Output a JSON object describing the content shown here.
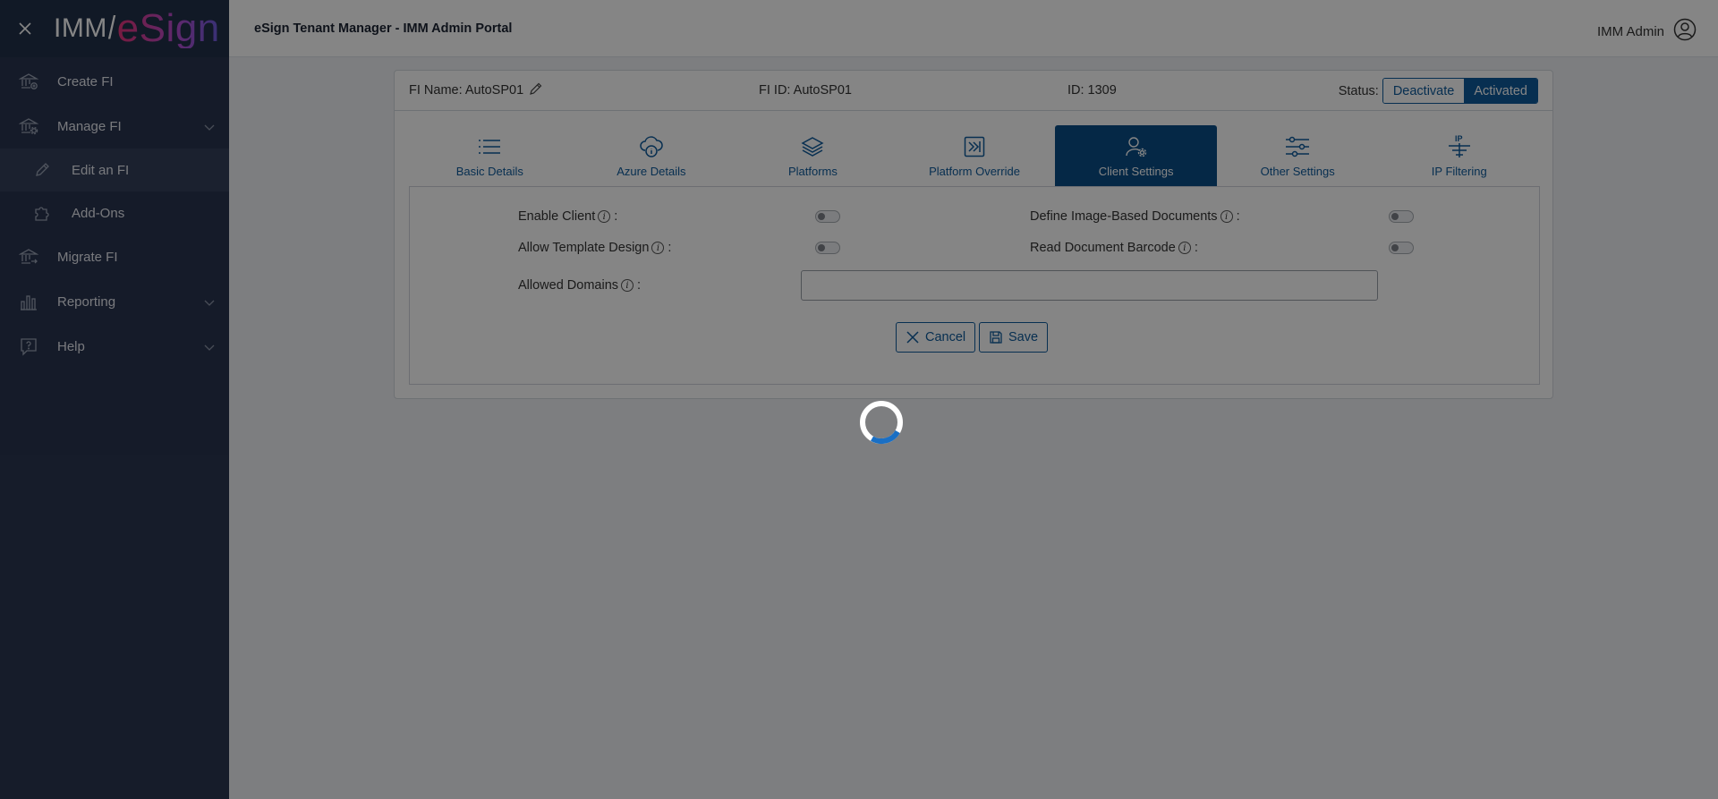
{
  "sidebar": {
    "logo_left": "IMM",
    "logo_right": "eSign",
    "items": [
      {
        "label": "Create FI"
      },
      {
        "label": "Manage FI"
      },
      {
        "label": "Edit an FI"
      },
      {
        "label": "Add-Ons"
      },
      {
        "label": "Migrate FI"
      },
      {
        "label": "Reporting"
      },
      {
        "label": "Help"
      }
    ]
  },
  "header": {
    "title": "eSign Tenant Manager - IMM Admin Portal",
    "user": "IMM Admin"
  },
  "fi": {
    "name": "FI Name: AutoSP01",
    "fi_id": "FI ID: AutoSP01",
    "id": "ID: 1309",
    "status_label": "Status:",
    "deactivate": "Deactivate",
    "activated": "Activated"
  },
  "tabs": [
    {
      "label": "Basic Details"
    },
    {
      "label": "Azure Details"
    },
    {
      "label": "Platforms"
    },
    {
      "label": "Platform Override"
    },
    {
      "label": "Client Settings"
    },
    {
      "label": "Other Settings"
    },
    {
      "label": "IP Filtering"
    }
  ],
  "client_settings": {
    "enable_client": "Enable Client",
    "allow_template_design": "Allow Template Design",
    "allowed_domains": "Allowed Domains",
    "define_image_based_documents": "Define Image-Based Documents",
    "read_document_barcode": "Read Document Barcode",
    "domains_value": "",
    "cancel": "Cancel",
    "save": "Save"
  },
  "colors": {
    "sidebar": "#2a3550",
    "primary": "#0e5a9b",
    "active_tab": "#0b4d86",
    "spinner": "#1a6fc4"
  }
}
